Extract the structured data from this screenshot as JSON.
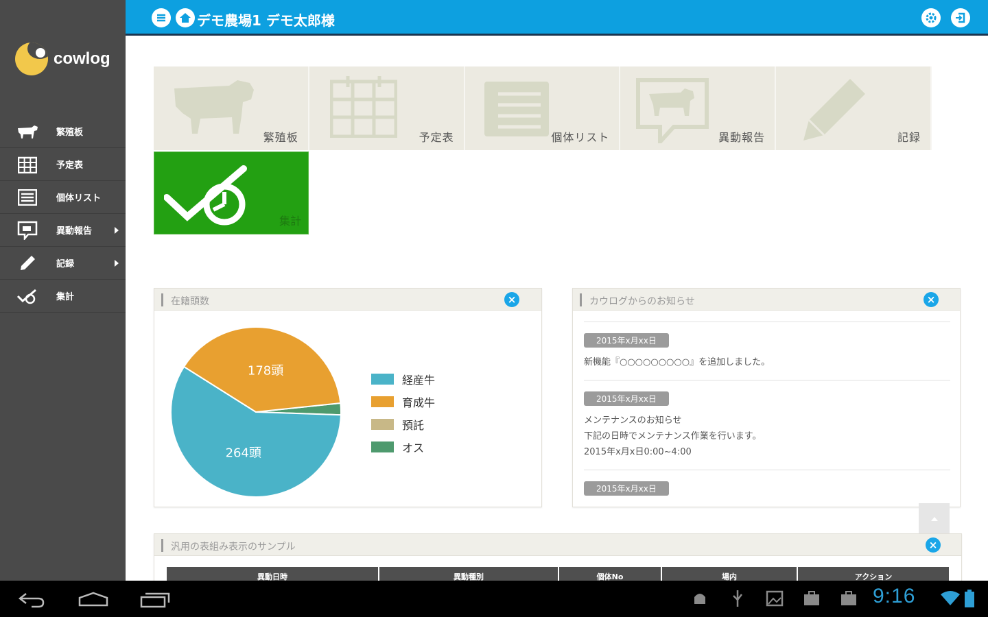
{
  "app": {
    "brand": "cowlog",
    "header_title": "デモ農場1 デモ太郎様"
  },
  "sidebar": {
    "items": [
      {
        "label": "繁殖板",
        "icon": "cow-icon",
        "has_submenu": false
      },
      {
        "label": "予定表",
        "icon": "calendar-icon",
        "has_submenu": false
      },
      {
        "label": "個体リスト",
        "icon": "list-icon",
        "has_submenu": false
      },
      {
        "label": "異動報告",
        "icon": "report-icon",
        "has_submenu": true
      },
      {
        "label": "記録",
        "icon": "pencil-icon",
        "has_submenu": true
      },
      {
        "label": "集計",
        "icon": "stats-icon",
        "has_submenu": false
      }
    ]
  },
  "tiles": [
    {
      "label": "繁殖板",
      "icon": "cow-icon"
    },
    {
      "label": "予定表",
      "icon": "calendar-icon"
    },
    {
      "label": "個体リスト",
      "icon": "list-icon"
    },
    {
      "label": "異動報告",
      "icon": "report-icon"
    },
    {
      "label": "記録",
      "icon": "pencil-icon"
    }
  ],
  "stats_tile": {
    "label": "集計",
    "icon": "stats-icon"
  },
  "herd_panel": {
    "title": "在籍頭数",
    "close": "×"
  },
  "chart_data": {
    "type": "pie",
    "title": "在籍頭数",
    "slices": [
      {
        "name": "経産牛",
        "value": 264,
        "label": "264頭",
        "color": "#4ab3c8"
      },
      {
        "name": "育成牛",
        "value": 178,
        "label": "178頭",
        "color": "#e8a030"
      },
      {
        "name": "預託",
        "value": 0,
        "label": "",
        "color": "#c8b887"
      },
      {
        "name": "オス",
        "value": 10,
        "label": "",
        "color": "#4e9a6e"
      }
    ],
    "legend": "right"
  },
  "news_panel": {
    "title": "カウログからのお知らせ",
    "close": "×",
    "items": [
      {
        "date": "2015年x月xx日",
        "lines": [
          "新機能『○○○○○○○○○』を追加しました。"
        ]
      },
      {
        "date": "2015年x月xx日",
        "lines": [
          "メンテナンスのお知らせ",
          "下記の日時でメンテナンス作業を行います。",
          "2015年x月x日0:00~4:00"
        ]
      },
      {
        "date": "2015年x月xx日",
        "lines": []
      }
    ]
  },
  "table_panel": {
    "title": "汎用の表組み表示のサンプル",
    "close": "×",
    "columns": [
      "異動日時",
      "異動種別",
      "個体No",
      "場内",
      "アクション"
    ]
  },
  "system_bar": {
    "clock": "9:16"
  },
  "colors": {
    "header": "#0da0e0",
    "sidebar": "#4a4a4a",
    "stats_tile": "#23a012",
    "close_button": "#1aa6e8"
  }
}
